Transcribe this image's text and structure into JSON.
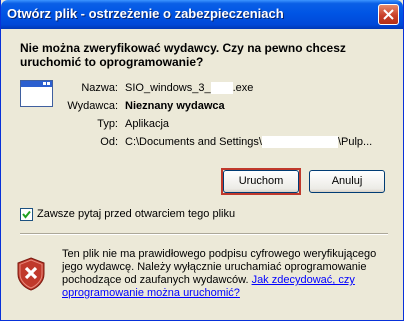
{
  "window": {
    "title": "Otwórz plik - ostrzeżenie o zabezpieczeniach"
  },
  "dialog": {
    "question": "Nie można zweryfikować wydawcy. Czy na pewno chcesz uruchomić to oprogramowanie?",
    "fields": {
      "name_label": "Nazwa:",
      "name_value_prefix": "SIO_windows_3_",
      "name_value_suffix": ".exe",
      "publisher_label": "Wydawca:",
      "publisher_value": "Nieznany wydawca",
      "type_label": "Typ:",
      "type_value": "Aplikacja",
      "from_label": "Od:",
      "from_value_prefix": "C:\\Documents and Settings\\",
      "from_value_suffix": "\\Pulp..."
    },
    "buttons": {
      "run": "Uruchom",
      "cancel": "Anuluj"
    },
    "checkbox": {
      "label": "Zawsze pytaj przed otwarciem tego pliku",
      "checked": true
    },
    "warning": {
      "text": "Ten plik nie ma prawidłowego podpisu cyfrowego weryfikującego jego wydawcę. Należy wyłącznie uruchamiać oprogramowanie pochodzące od zaufanych wydawców. ",
      "link": "Jak zdecydować, czy oprogramowanie można uruchomić?"
    }
  },
  "icons": [
    "close-icon",
    "application-icon",
    "checkmark-icon",
    "security-shield-icon"
  ],
  "colors": {
    "title_bar": "#0055e5",
    "dialog_bg": "#ece9d8",
    "link": "#0000ff",
    "shield": "#c0392b",
    "focus_border": "#c0392b"
  }
}
